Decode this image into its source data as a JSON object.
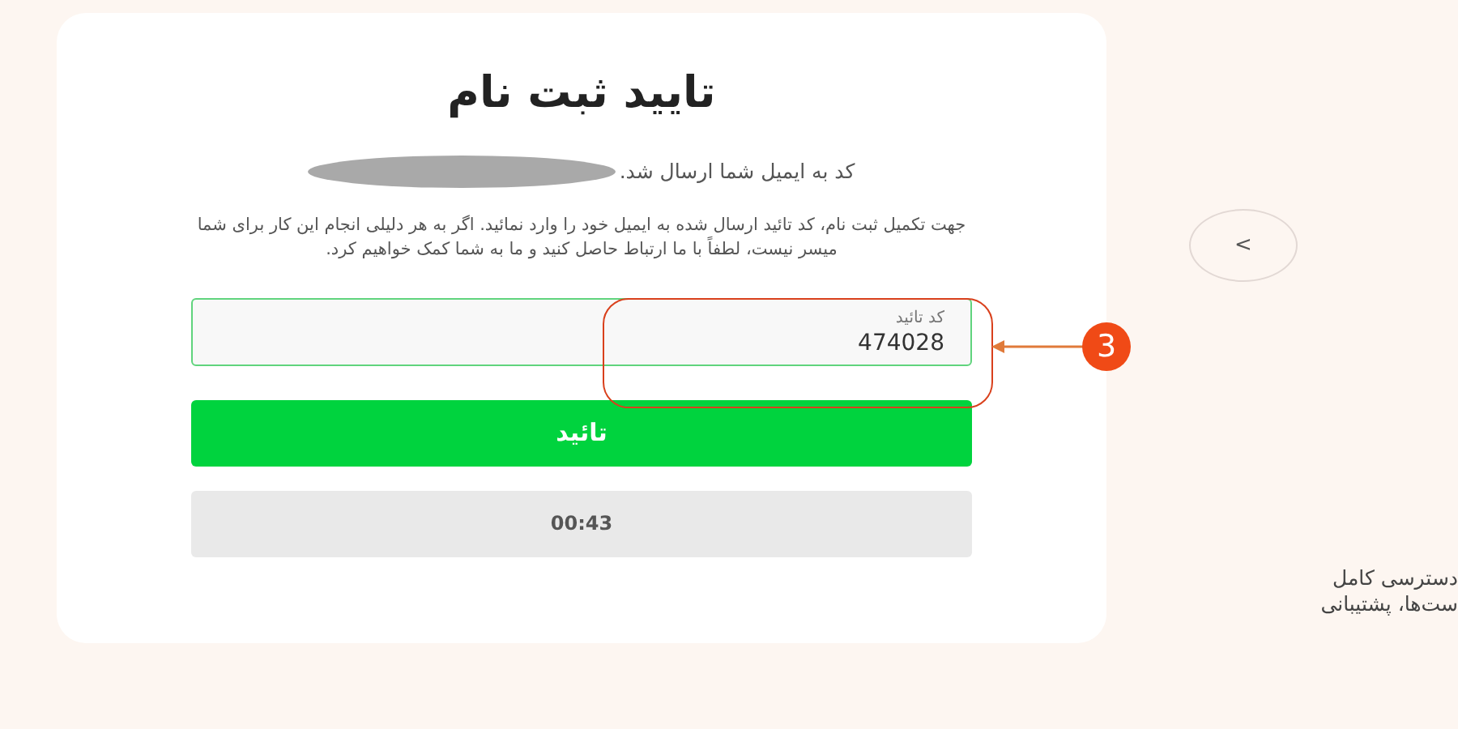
{
  "card": {
    "title": "تایید ثبت نام",
    "sent_notice": "کد به ایمیل شما ارسال شد.",
    "instructions": "جهت تکمیل ثبت نام، کد تائید ارسال شده به ایمیل خود را وارد نمائید. اگر به هر دلیلی انجام این کار برای شما میسر نیست، لطفاً با ما ارتباط حاصل کنید و ما به شما کمک خواهیم کرد.",
    "code_field": {
      "label": "کد تائید",
      "value": "474028"
    },
    "confirm_button": "تائید",
    "timer": "00:43"
  },
  "annotation": {
    "number": "3"
  },
  "side": {
    "prev_button": "<",
    "feature_lines": [
      "دسترسی کامل",
      "ست‌ها، پشتیبانی"
    ]
  }
}
